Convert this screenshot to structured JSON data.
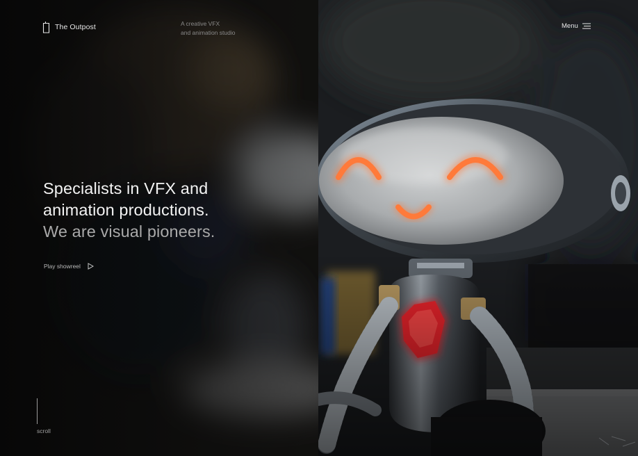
{
  "brand": {
    "name": "The Outpost",
    "icon": "outpost-logo-icon"
  },
  "tagline": {
    "line1": "A creative VFX",
    "line2": "and animation studio"
  },
  "menu": {
    "label": "Menu",
    "icon": "hamburger-menu-icon"
  },
  "hero": {
    "headline": {
      "line1": "Specialists in VFX and",
      "line2": "animation productions.",
      "line3": "We are visual pioneers."
    },
    "showreel": {
      "label": "Play showreel",
      "icon": "play-icon"
    },
    "background": "robot-lamp-photo"
  },
  "scroll": {
    "label": "scroll"
  },
  "colors": {
    "background": "#0b0b0c",
    "text": "#f3f3f3",
    "muted_text": "#a9a9a9",
    "robot_eyes": "#ff7a3a",
    "robot_heart": "#e8232b"
  }
}
